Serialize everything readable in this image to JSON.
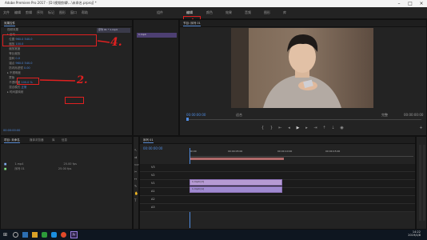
{
  "titlebar": {
    "title": "Adobe Premiere Pro 2017 - [D:\\视频剪辑\\...\\未命名.prproj] *"
  },
  "menu": {
    "items": [
      "文件",
      "编辑",
      "剪辑",
      "序列",
      "标记",
      "图形",
      "窗口",
      "帮助"
    ],
    "workspaces": [
      "组件",
      "编辑",
      "颜色",
      "效果",
      "音频",
      "图形",
      "库"
    ],
    "active_workspace": "编辑"
  },
  "effect_controls": {
    "tab": "效果控件",
    "clip_name": "序列 01 * 1.mp4",
    "rows": [
      {
        "label": "视频效果",
        "value": ""
      },
      {
        "label": "运动",
        "value": ""
      },
      {
        "label": "位置",
        "value": "960.0  540.0"
      },
      {
        "label": "缩放",
        "value": "100.0"
      },
      {
        "label": "缩放宽度",
        "value": ""
      },
      {
        "label": "等比缩放",
        "value": ""
      },
      {
        "label": "旋转",
        "value": "0.0"
      },
      {
        "label": "锚点",
        "value": "960.0  540.0"
      },
      {
        "label": "防闪烁滤镜",
        "value": "0.00"
      },
      {
        "label": "不透明度",
        "value": ""
      },
      {
        "label": "蒙版",
        "value": ""
      },
      {
        "label": "不透明度",
        "value": "100.0 %"
      },
      {
        "label": "混合模式",
        "value": "正常"
      },
      {
        "label": "时间重映射",
        "value": ""
      }
    ],
    "timecode": "00:00:00:00"
  },
  "project": {
    "tabs": [
      "项目: 未命名",
      "媒体浏览器",
      "库",
      "信息"
    ],
    "items": [
      {
        "name": "1.mp4",
        "rate": "25.00 fps"
      },
      {
        "name": "序列 01",
        "rate": "25.00 fps"
      }
    ]
  },
  "program": {
    "tab": "节目: 序列 01",
    "timecode": "00:00:00:00",
    "fit": "适合",
    "scale": "完整",
    "duration": "00:00:00:00"
  },
  "timeline": {
    "tab": "序列 01",
    "timecode": "00:00:00:00",
    "ruler": [
      "00:00",
      "00:00:05:00",
      "00:00:10:00",
      "00:00:15:00"
    ],
    "tracks": [
      "V3",
      "V2",
      "V1",
      "A1",
      "A2",
      "A3"
    ],
    "clips": [
      {
        "label": "1.mp4 [V]",
        "track": "V1"
      },
      {
        "label": "1.mp4 [A]",
        "track": "A1"
      }
    ]
  },
  "annotations": [
    "1.",
    "2.",
    "3.",
    "4."
  ],
  "taskbar": {
    "time": "14:22",
    "date": "2019/4/8"
  }
}
